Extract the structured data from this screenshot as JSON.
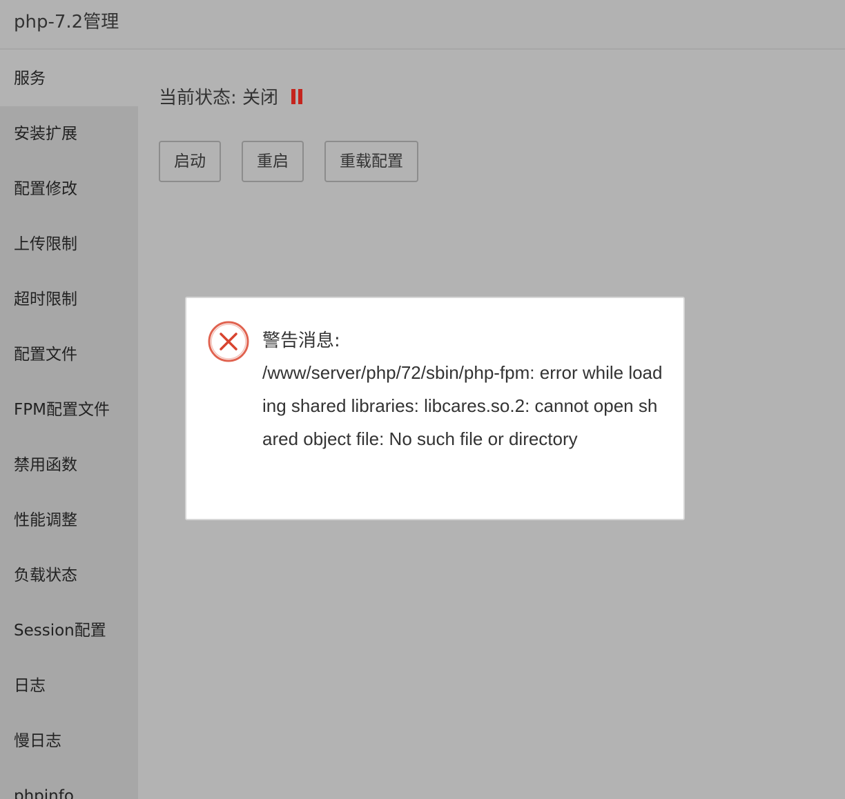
{
  "window": {
    "title": "php-7.2管理"
  },
  "sidebar": {
    "items": [
      {
        "label": "服务"
      },
      {
        "label": "安装扩展"
      },
      {
        "label": "配置修改"
      },
      {
        "label": "上传限制"
      },
      {
        "label": "超时限制"
      },
      {
        "label": "配置文件"
      },
      {
        "label": "FPM配置文件"
      },
      {
        "label": "禁用函数"
      },
      {
        "label": "性能调整"
      },
      {
        "label": "负载状态"
      },
      {
        "label": "Session配置"
      },
      {
        "label": "日志"
      },
      {
        "label": "慢日志"
      },
      {
        "label": "phpinfo"
      }
    ],
    "active_index": 0
  },
  "service": {
    "status_label": "当前状态:",
    "status_value": "关闭",
    "status_icon": "pause-icon",
    "status_color": "#c4241d",
    "buttons": {
      "start": "启动",
      "restart": "重启",
      "reload": "重载配置"
    }
  },
  "dialog": {
    "icon": "error-circle-x-icon",
    "icon_color": "#e0624f",
    "heading": "警告消息:",
    "message": "/www/server/php/72/sbin/php-fpm: error while loading shared libraries: libcares.so.2: cannot open shared object file: No such file or directory"
  }
}
